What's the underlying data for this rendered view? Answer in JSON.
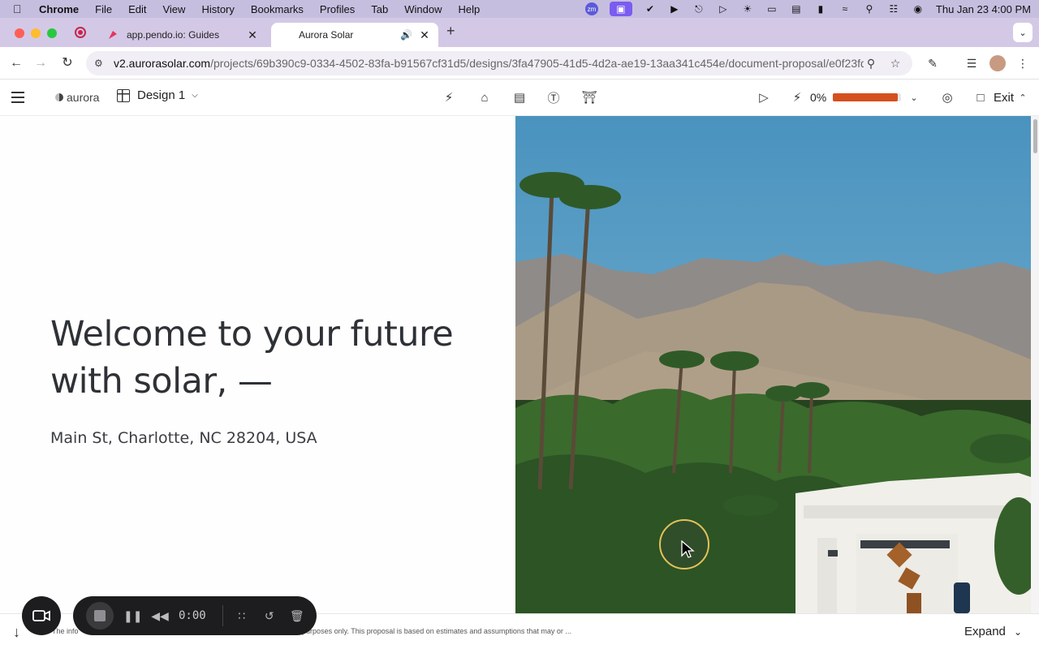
{
  "menubar": {
    "app": "Chrome",
    "items": [
      "File",
      "Edit",
      "View",
      "History",
      "Bookmarks",
      "Profiles",
      "Tab",
      "Window",
      "Help"
    ],
    "clock": "Thu Jan 23  4:00 PM",
    "zoom_badge": "zm"
  },
  "tabs": [
    {
      "title": "app.pendo.io: Guides",
      "active": false
    },
    {
      "title": "Aurora Solar",
      "active": true
    }
  ],
  "address_bar": {
    "host": "v2.aurorasolar.com",
    "path": "/projects/69b390c9-0334-4502-83fa-b91567cf31d5/designs/3fa47905-41d5-4d2a-ae19-13aa341c454e/document-proposal/e0f23fd..."
  },
  "app_header": {
    "logo_text": "aurora",
    "design_label": "Design 1",
    "progress_label": "0%",
    "progress_fraction": 0.95,
    "exit_label": "Exit"
  },
  "proposal": {
    "headline": "Welcome to your future with solar, —",
    "address": "Main St, Charlotte, NC 28204, USA"
  },
  "footer": {
    "disclaimer_left": "The info",
    "disclaimer_right": "tration purposes only. This proposal is based on estimates and assumptions that may or ...",
    "expand_label": "Expand"
  },
  "recorder": {
    "time": "0:00"
  },
  "colors": {
    "menubar_bg": "#c6bedf",
    "tabbar_bg": "#d3c9e6",
    "progress_fill": "#d4501e"
  }
}
